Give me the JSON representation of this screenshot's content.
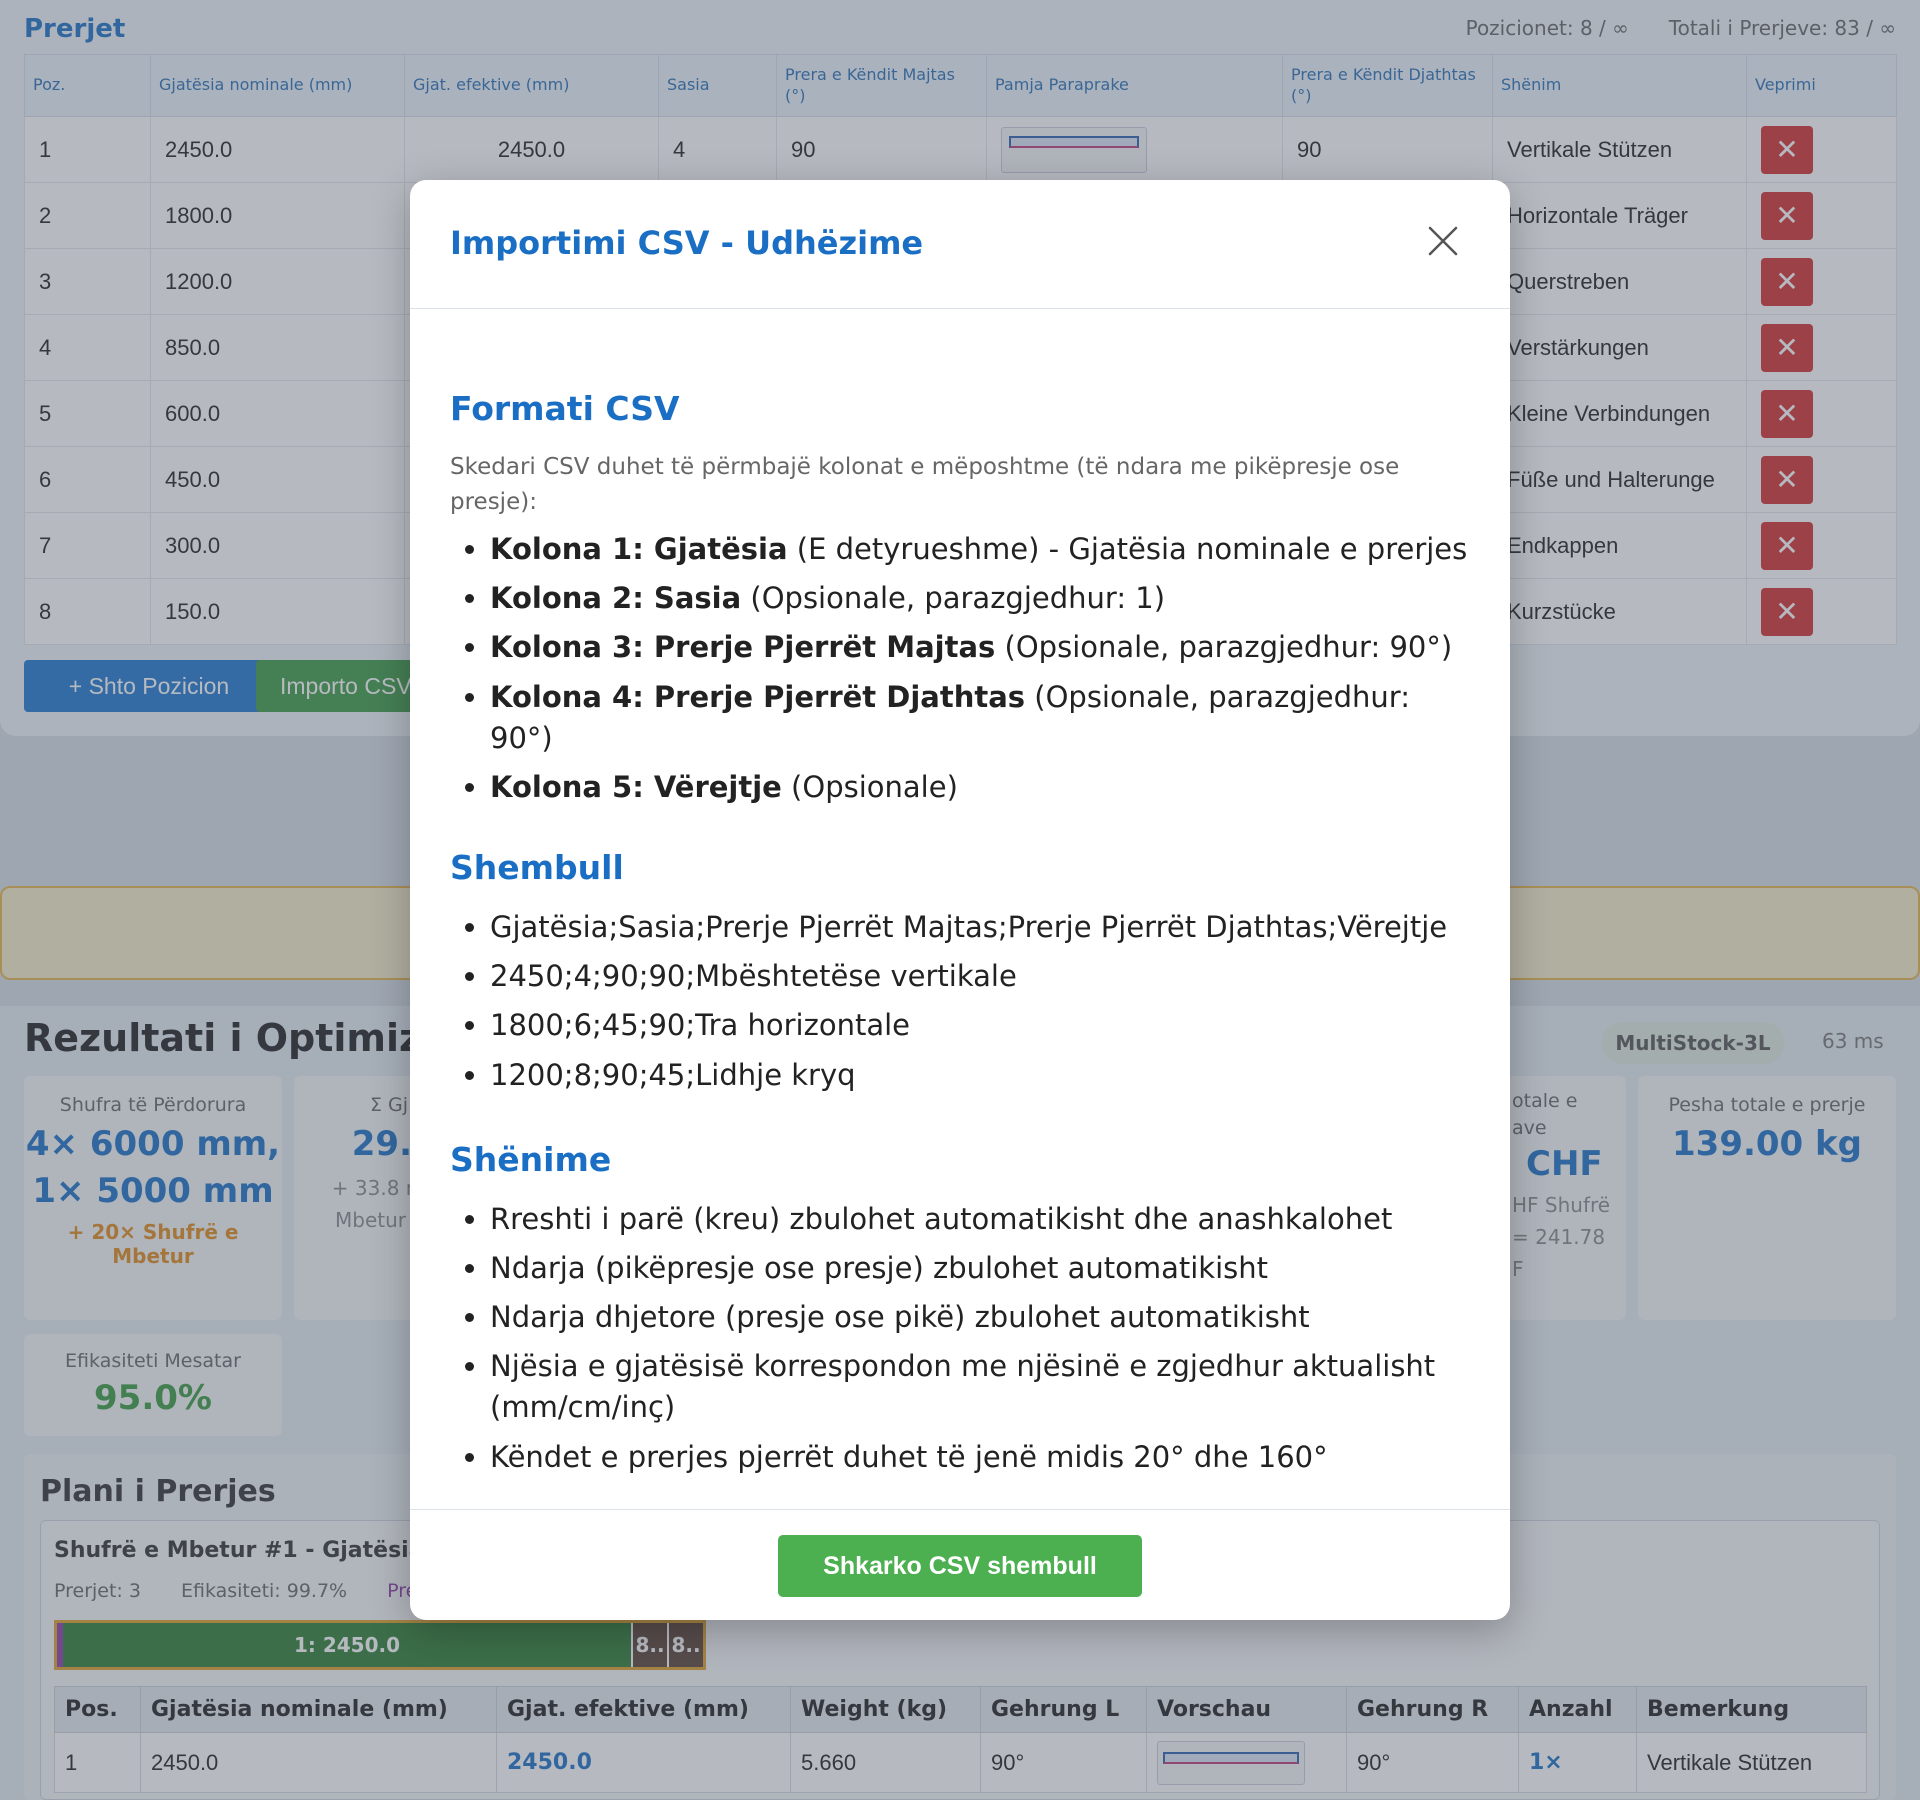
{
  "cuts_panel": {
    "title": "Prerjet",
    "positions_stat": "Pozicionet: 8 / ∞",
    "total_stat": "Totali i Prerjeve: 83 / ∞",
    "columns": [
      "Poz.",
      "Gjatësia nominale (mm)",
      "Gjat. efektive (mm)",
      "Sasia",
      "Prera e Këndit Majtas (°)",
      "Pamja Paraprake",
      "Prera e Këndit Djathtas (°)",
      "Shënim",
      "Veprimi"
    ],
    "rows": [
      {
        "pos": "1",
        "length": "2450.0",
        "effective": "2450.0",
        "qty": "4",
        "angle_l": "90",
        "angle_r": "90",
        "note": "Vertikale Stützen"
      },
      {
        "pos": "2",
        "length": "1800.0",
        "note": "Horizontale Träger"
      },
      {
        "pos": "3",
        "length": "1200.0",
        "note": "Querstreben"
      },
      {
        "pos": "4",
        "length": "850.0",
        "note": "Verstärkungen"
      },
      {
        "pos": "5",
        "length": "600.0",
        "note": "Kleine Verbindungen"
      },
      {
        "pos": "6",
        "length": "450.0",
        "note": "Füße und Halterunge"
      },
      {
        "pos": "7",
        "length": "300.0",
        "note": "Endkappen"
      },
      {
        "pos": "8",
        "length": "150.0",
        "note": "Kurzstücke"
      }
    ],
    "delete_glyph": "✕",
    "add_button": "+ Shto Pozicion",
    "import_button": "Importo CSV"
  },
  "results": {
    "title": "Rezultati i Optimizimit",
    "algorithm": "MultiStock-3L",
    "time": "63 ms",
    "card_bars": {
      "label": "Shufra të Përdorura",
      "value_line1": "4× 6000 mm,",
      "value_line2": "1× 5000 mm",
      "extra": "+ 20× Shufrë e Mbetur"
    },
    "card_sum": {
      "label": "Σ Gj",
      "value": "29.",
      "sub1": "+ 33.8 r",
      "sub2": "Mbetur"
    },
    "card_cost": {
      "label1": "otale e",
      "label2": "ave",
      "value": "CHF",
      "sub1": "HF Shufrë",
      "sub2": "= 241.78",
      "sub3": "F"
    },
    "card_weight": {
      "label": "Pesha totale e prerje",
      "value": "139.00 kg"
    },
    "card_eff": {
      "label": "Efikasiteti Mesatar",
      "value": "95.0%"
    }
  },
  "plan": {
    "title": "Plani i Prerjes",
    "bar_title": "Shufrë e Mbetur #1 - Gjatësia",
    "meta_cuts": "Prerjet: 3",
    "meta_eff": "Efikasiteti: 99.7%",
    "meta_extra": "Pre",
    "seg1": "1: 2450.0",
    "seg2": "8..",
    "seg3": "8..",
    "columns": [
      "Pos.",
      "Gjatësia nominale (mm)",
      "Gjat. efektive (mm)",
      "Weight (kg)",
      "Gehrung L",
      "Vorschau",
      "Gehrung R",
      "Anzahl",
      "Bemerkung"
    ],
    "row": {
      "pos": "1",
      "length": "2450.0",
      "effective": "2450.0",
      "weight": "5.660",
      "angle_l": "90°",
      "angle_r": "90°",
      "count": "1×",
      "note": "Vertikale Stützen"
    }
  },
  "modal": {
    "title": "Importimi CSV - Udhëzime",
    "format_heading": "Formati CSV",
    "format_intro": "Skedari CSV duhet të përmbajë kolonat e mëposhtme (të ndara me pikëpresje ose presje):",
    "columns": [
      {
        "name": "Kolona 1: Gjatësia",
        "desc": " (E detyrueshme) - Gjatësia nominale e prerjes"
      },
      {
        "name": "Kolona 2: Sasia",
        "desc": " (Opsionale, parazgjedhur: 1)"
      },
      {
        "name": "Kolona 3: Prerje Pjerrët Majtas",
        "desc": " (Opsionale, parazgjedhur: 90°)"
      },
      {
        "name": "Kolona 4: Prerje Pjerrët Djathtas",
        "desc": " (Opsionale, parazgjedhur: 90°)"
      },
      {
        "name": "Kolona 5: Vërejtje",
        "desc": " (Opsionale)"
      }
    ],
    "example_heading": "Shembull",
    "example_lines": [
      "Gjatësia;Sasia;Prerje Pjerrët Majtas;Prerje Pjerrët Djathtas;Vërejtje",
      "2450;4;90;90;Mbështetëse vertikale",
      "1800;6;45;90;Tra horizontale",
      "1200;8;90;45;Lidhje kryq"
    ],
    "notes_heading": "Shënime",
    "notes": [
      "Rreshti i parë (kreu) zbulohet automatikisht dhe anashkalohet",
      "Ndarja (pikëpresje ose presje) zbulohet automatikisht",
      "Ndarja dhjetore (presje ose pikë) zbulohet automatikisht",
      "Njësia e gjatësisë korrespondon me njësinë e zgjedhur aktualisht (mm/cm/inç)",
      "Këndet e prerjes pjerrët duhet të jenë midis 20° dhe 160°"
    ],
    "download_button": "Shkarko CSV shembull"
  }
}
